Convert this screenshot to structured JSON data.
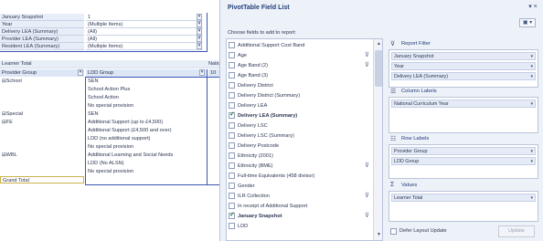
{
  "sheet": {
    "filters": [
      {
        "label": "January Snapshot",
        "value": "1"
      },
      {
        "label": "Year",
        "value": "(Multiple Items)"
      },
      {
        "label": "Delivery LEA (Summary)",
        "value": "(All)"
      },
      {
        "label": "Provider LEA (Summary)",
        "value": "(All)"
      },
      {
        "label": "Resident LEA (Summary)",
        "value": "(Multiple Items)"
      }
    ],
    "values_header": "Learner Total",
    "values_header_right": "Natio",
    "row_header_1": "Provider Group",
    "row_header_2": "LDD Group",
    "col_value_header": "10",
    "rows": [
      {
        "group": "⊟School",
        "sub": "SEN"
      },
      {
        "group": "",
        "sub": "School Action Plus"
      },
      {
        "group": "",
        "sub": "School Action"
      },
      {
        "group": "",
        "sub": "No special provision"
      },
      {
        "group": "⊟Special",
        "sub": "SEN"
      },
      {
        "group": "⊟FE",
        "sub": "Additional Support (up to £4,500)"
      },
      {
        "group": "",
        "sub": "Additional Support (£4,500 and over)"
      },
      {
        "group": "",
        "sub": "LDD (no additional support)"
      },
      {
        "group": "",
        "sub": "No special provision"
      },
      {
        "group": "⊟WBL",
        "sub": "Additional Learning and Social Needs"
      },
      {
        "group": "",
        "sub": "LDD (No ALSN)"
      },
      {
        "group": "",
        "sub": "No special provision"
      }
    ],
    "grand_total": "Grand Total"
  },
  "panel": {
    "title": "PivotTable Field List",
    "close_glyph": "▾ ×",
    "layout_btn": "▣ ▾",
    "choose_label": "Choose fields to add to report:",
    "fields": [
      {
        "label": "Additional Support Cost Band",
        "checked": false,
        "bold": false,
        "filtered": false
      },
      {
        "label": "Age",
        "checked": false,
        "bold": false,
        "filtered": true
      },
      {
        "label": "Age Band (2)",
        "checked": false,
        "bold": false,
        "filtered": true
      },
      {
        "label": "Age Band (3)",
        "checked": false,
        "bold": false,
        "filtered": false
      },
      {
        "label": "Delivery District",
        "checked": false,
        "bold": false,
        "filtered": false
      },
      {
        "label": "Delivery District (Summary)",
        "checked": false,
        "bold": false,
        "filtered": false
      },
      {
        "label": "Delivery LEA",
        "checked": false,
        "bold": false,
        "filtered": false
      },
      {
        "label": "Delivery LEA (Summary)",
        "checked": true,
        "bold": true,
        "filtered": false
      },
      {
        "label": "Delivery LSC",
        "checked": false,
        "bold": false,
        "filtered": false
      },
      {
        "label": "Delivery LSC (Summary)",
        "checked": false,
        "bold": false,
        "filtered": false
      },
      {
        "label": "Delivery Postcode",
        "checked": false,
        "bold": false,
        "filtered": false
      },
      {
        "label": "Ethnicity (2001)",
        "checked": false,
        "bold": false,
        "filtered": false
      },
      {
        "label": "Ethnicity (BME)",
        "checked": false,
        "bold": false,
        "filtered": true
      },
      {
        "label": "Full-time Equivalents (458 divisor)",
        "checked": false,
        "bold": false,
        "filtered": false
      },
      {
        "label": "Gender",
        "checked": false,
        "bold": false,
        "filtered": false
      },
      {
        "label": "ILR Collection",
        "checked": false,
        "bold": false,
        "filtered": true
      },
      {
        "label": "In receipt of Additional Support",
        "checked": false,
        "bold": false,
        "filtered": false
      },
      {
        "label": "January Snapshot",
        "checked": true,
        "bold": true,
        "filtered": true
      },
      {
        "label": "LDD",
        "checked": false,
        "bold": false,
        "filtered": false
      }
    ],
    "scroll_up": "▲",
    "scroll_down": "▼",
    "report_filter": {
      "title": "Report Filter",
      "icon": "⊽",
      "items": [
        "January Snapshot",
        "Year",
        "Delivery LEA (Summary)"
      ]
    },
    "column_labels": {
      "title": "Column Labels",
      "icon": "☰",
      "items": [
        "National Curriculum Year"
      ]
    },
    "row_labels": {
      "title": "Row Labels",
      "icon": "☷",
      "items": [
        "Provider Group",
        "LDD Group"
      ]
    },
    "values": {
      "title": "Values",
      "icon": "Σ",
      "items": [
        "Learner Total"
      ]
    },
    "defer_label": "Defer Layout Update",
    "update_label": "Update",
    "caret": "▾"
  }
}
